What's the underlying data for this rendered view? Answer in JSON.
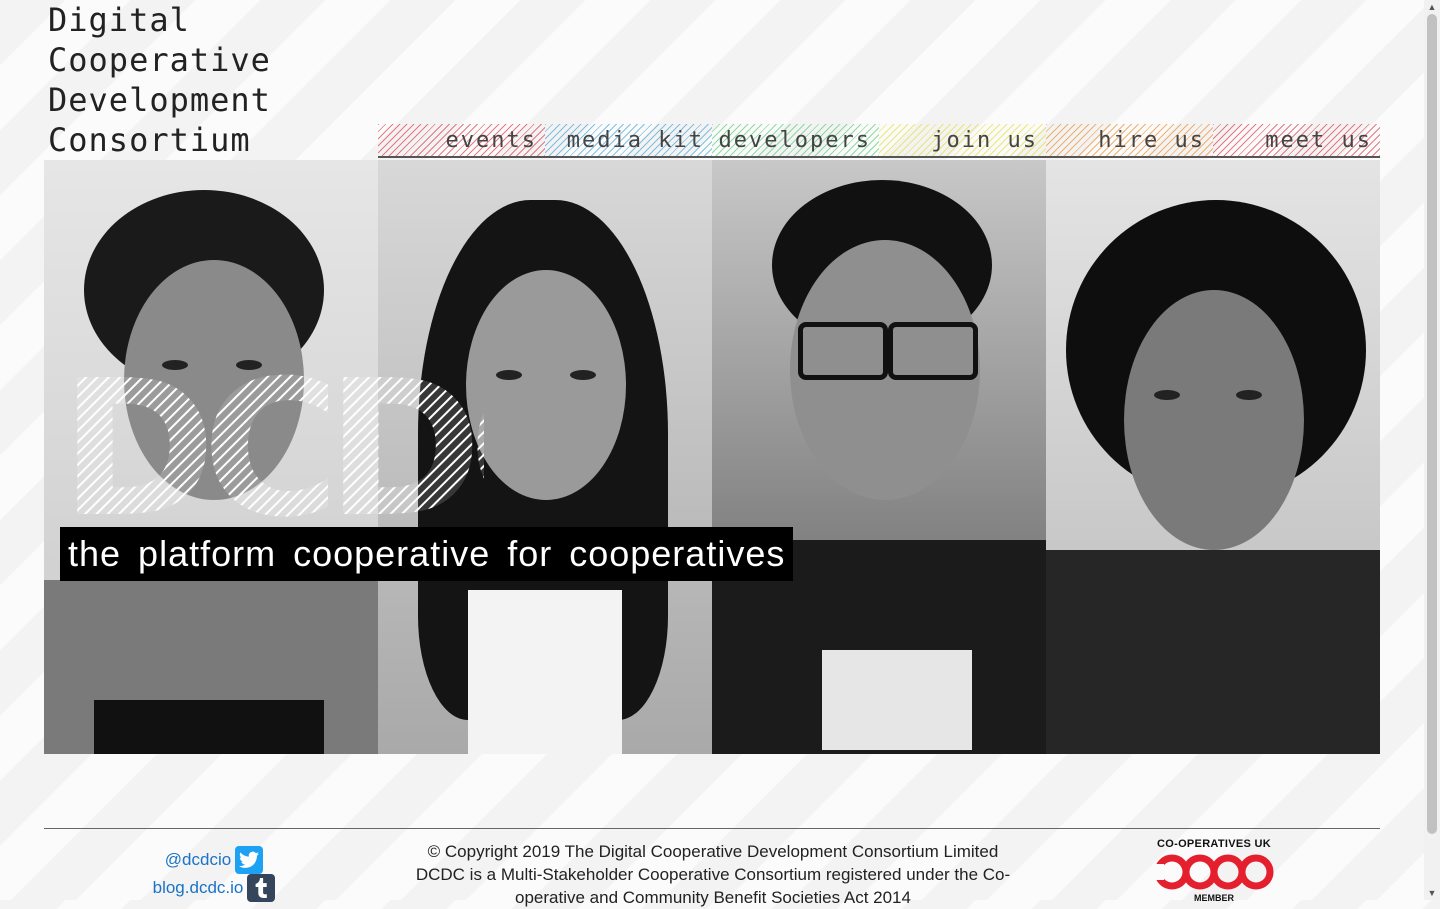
{
  "site": {
    "title_lines": [
      "Digital",
      "Cooperative",
      "Development",
      "Consortium"
    ]
  },
  "nav": {
    "items": [
      {
        "label": "events",
        "color": "#e04050"
      },
      {
        "label": "media kit",
        "color": "#4aa8d8"
      },
      {
        "label": "developers",
        "color": "#5ccf7a"
      },
      {
        "label": "join us",
        "color": "#e4e040"
      },
      {
        "label": "hire us",
        "color": "#f09030"
      },
      {
        "label": "meet us",
        "color": "#e04050"
      }
    ]
  },
  "hero": {
    "logo_text": "DCDC",
    "tagline": "the platform cooperative for cooperatives"
  },
  "footer": {
    "twitter_label": "@dcdcio",
    "blog_label": "blog.dcdc.io",
    "copyright": "© Copyright 2019 The Digital Cooperative Development Consortium Limited",
    "legal": "DCDC is a Multi-Stakeholder Cooperative Consortium registered under the Co-operative and Community Benefit Societies Act 2014",
    "coop_badge": {
      "top": "CO-OPERATIVES UK",
      "word": "coop",
      "bottom": "MEMBER",
      "color": "#e5202e"
    }
  },
  "colors": {
    "twitter": "#1da1f2",
    "tumblr": "#35465c",
    "link": "#1a73c7"
  }
}
